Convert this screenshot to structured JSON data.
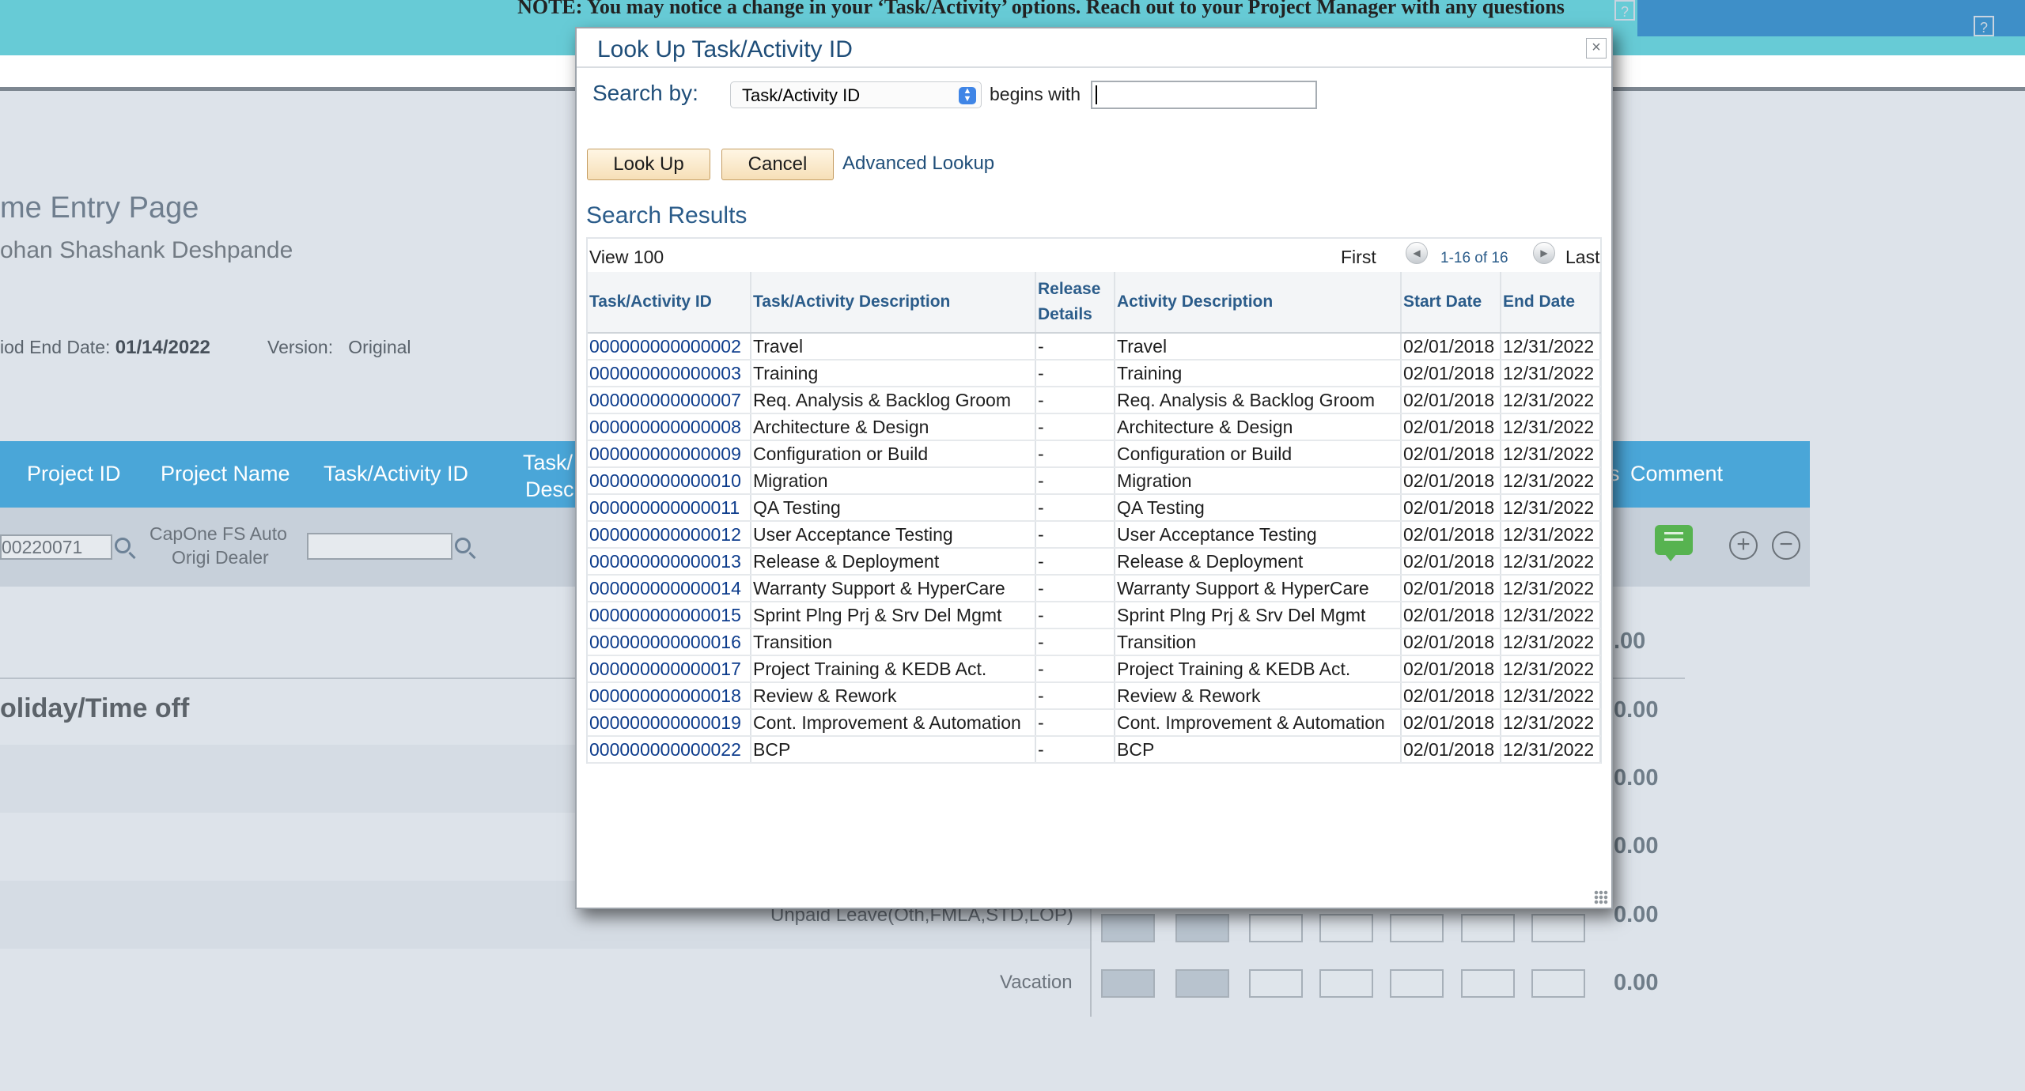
{
  "background": {
    "note": "NOTE: You may notice a change in your ‘Task/Activity’ options. Reach out to your Project Manager with any questions",
    "help_icon": "?",
    "page_title": "me Entry Page",
    "employee_name": "ohan Shashank Deshpande",
    "period_end_label": "iod End Date:",
    "period_end_value": "01/14/2022",
    "version_label": "Version:",
    "version_value": "Original",
    "grid_headers": [
      "Project ID",
      "Project Name",
      "Task/Activity ID",
      "Task/",
      "Desc",
      "s",
      "Comment"
    ],
    "row": {
      "project_id": "00220071",
      "project_name_line1": "CapOne FS Auto",
      "project_name_line2": "Origi Dealer"
    },
    "holiday_section": "oliday/Time off",
    "unpaid_leave": "Unpaid Leave(Oth,FMLA,STD,LOP)",
    "vacation": "Vacation",
    "totals": [
      ".00",
      "0.00",
      "0.00",
      "0.00",
      "0.00",
      "0.00"
    ]
  },
  "modal": {
    "title": "Look Up Task/Activity ID",
    "close_glyph": "×",
    "search_by_label": "Search by:",
    "search_by_value": "Task/Activity ID",
    "operator_label": "begins with",
    "search_value": "",
    "lookup_button": "Look Up",
    "cancel_button": "Cancel",
    "advanced_link": "Advanced Lookup",
    "results_heading": "Search Results",
    "view_link": "View 100",
    "first_label": "First",
    "last_label": "Last",
    "count_text": "1-16 of 16",
    "columns": [
      "Task/Activity ID",
      "Task/Activity Description",
      "Release Details",
      "Activity Description",
      "Start Date",
      "End Date"
    ],
    "rows": [
      [
        "000000000000002",
        "Travel",
        "-",
        "Travel",
        "02/01/2018",
        "12/31/2022"
      ],
      [
        "000000000000003",
        "Training",
        "-",
        "Training",
        "02/01/2018",
        "12/31/2022"
      ],
      [
        "000000000000007",
        "Req. Analysis & Backlog Groom",
        "-",
        "Req. Analysis & Backlog Groom",
        "02/01/2018",
        "12/31/2022"
      ],
      [
        "000000000000008",
        "Architecture & Design",
        "-",
        "Architecture & Design",
        "02/01/2018",
        "12/31/2022"
      ],
      [
        "000000000000009",
        "Configuration or Build",
        "-",
        "Configuration or Build",
        "02/01/2018",
        "12/31/2022"
      ],
      [
        "000000000000010",
        "Migration",
        "-",
        "Migration",
        "02/01/2018",
        "12/31/2022"
      ],
      [
        "000000000000011",
        "QA Testing",
        "-",
        "QA Testing",
        "02/01/2018",
        "12/31/2022"
      ],
      [
        "000000000000012",
        "User Acceptance Testing",
        "-",
        "User Acceptance Testing",
        "02/01/2018",
        "12/31/2022"
      ],
      [
        "000000000000013",
        "Release & Deployment",
        "-",
        "Release & Deployment",
        "02/01/2018",
        "12/31/2022"
      ],
      [
        "000000000000014",
        "Warranty Support & HyperCare",
        "-",
        "Warranty Support & HyperCare",
        "02/01/2018",
        "12/31/2022"
      ],
      [
        "000000000000015",
        "Sprint Plng Prj & Srv Del Mgmt",
        "-",
        "Sprint Plng Prj & Srv Del Mgmt",
        "02/01/2018",
        "12/31/2022"
      ],
      [
        "000000000000016",
        "Transition",
        "-",
        "Transition",
        "02/01/2018",
        "12/31/2022"
      ],
      [
        "000000000000017",
        "Project Training & KEDB Act.",
        "-",
        "Project Training & KEDB Act.",
        "02/01/2018",
        "12/31/2022"
      ],
      [
        "000000000000018",
        "Review & Rework",
        "-",
        "Review & Rework",
        "02/01/2018",
        "12/31/2022"
      ],
      [
        "000000000000019",
        "Cont. Improvement & Automation",
        "-",
        "Cont. Improvement & Automation",
        "02/01/2018",
        "12/31/2022"
      ],
      [
        "000000000000022",
        "BCP",
        "-",
        "BCP",
        "02/01/2018",
        "12/31/2022"
      ]
    ]
  },
  "colors": {
    "top_banner": "#67cbd6",
    "grid_header": "#4aa6d8",
    "link": "#0d3c8c",
    "modal_title": "#1f4e79",
    "comment_icon": "#57b350"
  }
}
